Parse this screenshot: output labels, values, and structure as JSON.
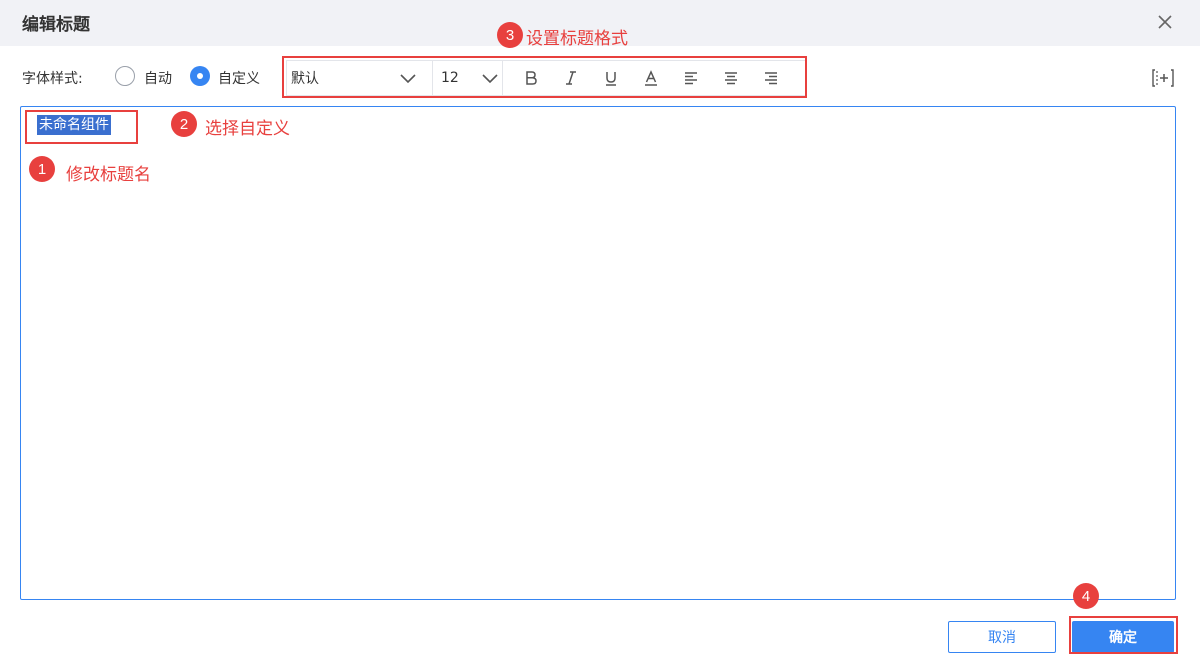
{
  "dialog": {
    "title": "编辑标题"
  },
  "font_style": {
    "label": "字体样式:",
    "options": [
      {
        "label": "自动",
        "selected": false
      },
      {
        "label": "自定义",
        "selected": true
      }
    ]
  },
  "toolbar": {
    "font_family": "默认",
    "font_size": "12"
  },
  "editor": {
    "value": "未命名组件"
  },
  "buttons": {
    "cancel": "取消",
    "ok": "确定"
  },
  "annotations": [
    {
      "num": "1",
      "text": "修改标题名"
    },
    {
      "num": "2",
      "text": "选择自定义"
    },
    {
      "num": "3",
      "text": "设置标题格式"
    },
    {
      "num": "4",
      "text": ""
    }
  ],
  "colors": {
    "accent": "#3685f2",
    "annotation": "#e8403e",
    "header_bg": "#f1f2f6"
  }
}
